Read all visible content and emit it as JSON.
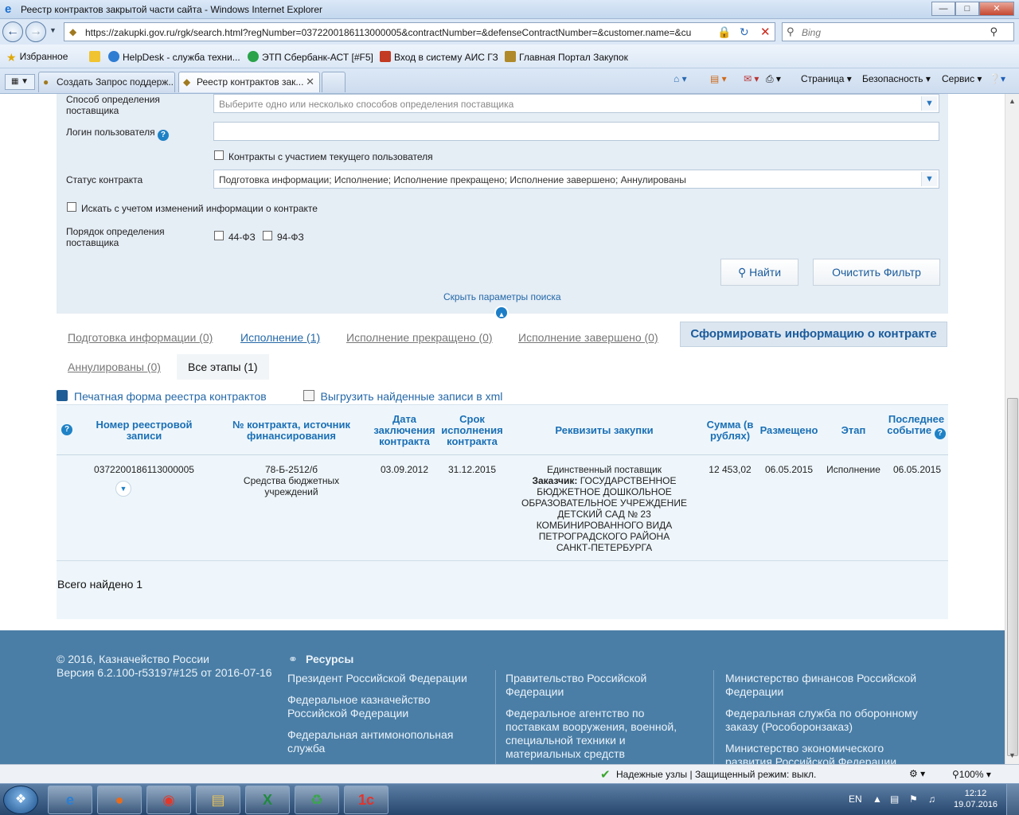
{
  "window": {
    "title": "Реестр контрактов закрытой части сайта - Windows Internet Explorer",
    "url": "https://zakupki.gov.ru/rgk/search.html?regNumber=0372200186113000005&contractNumber=&defenseContractNumber=&customer.name=&cu",
    "search_placeholder": "Bing"
  },
  "favorites": {
    "label": "Избранное",
    "items": [
      "HelpDesk - служба техни...",
      "ЭТП Сбербанк-АСТ [#F5]",
      "Вход в систему  АИС ГЗ",
      "Главная Портал Закупок"
    ]
  },
  "tabs": [
    {
      "label": "Создать Запрос поддерж..."
    },
    {
      "label": "Реестр контрактов зак..."
    }
  ],
  "commands": [
    "Страница",
    "Безопасность",
    "Сервис"
  ],
  "filter": {
    "method_label": "Способ определения поставщика",
    "method_placeholder": "Выберите одно или несколько способов определения поставщика",
    "login_label": "Логин пользователя",
    "login_value": "",
    "my_contracts_label": "Контракты с участием текущего пользователя",
    "status_label": "Статус контракта",
    "status_value": "Подготовка информации; Исполнение; Исполнение прекращено; Исполнение завершено; Аннулированы",
    "search_changes_label": "Искать с учетом изменений информации о контракте",
    "order_label": "Порядок определения поставщика",
    "law44": "44-ФЗ",
    "law94": "94-ФЗ",
    "find_button": "Найти",
    "clear_button": "Очистить Фильтр",
    "hide_link": "Скрыть параметры поиска"
  },
  "stage_tabs": [
    "Подготовка информации (0)",
    "Исполнение (1)",
    "Исполнение прекращено (0)",
    "Исполнение завершено (0)",
    "Аннулированы (0)",
    "Все этапы (1)"
  ],
  "form_button": "Сформировать информацию о контракте",
  "tools": {
    "print": "Печатная форма реестра контрактов",
    "export": "Выгрузить найденные записи в xml"
  },
  "table": {
    "headers": {
      "reg": "Номер реестровой записи",
      "contract": "№ контракта, источник финансирования",
      "date": "Дата заключения контракта",
      "term": "Срок исполнения контракта",
      "req": "Реквизиты закупки",
      "sum": "Сумма (в рублях)",
      "placed": "Размещено",
      "stage": "Этап",
      "last": "Последнее событие"
    },
    "row": {
      "reg": "0372200186113000005",
      "contract_no": "78-Б-2512/б",
      "funding": "Средства бюджетных учреждений",
      "date": "03.09.2012",
      "term": "31.12.2015",
      "method": "Единственный поставщик",
      "customer_label": "Заказчик:",
      "customer": "ГОСУДАРСТВЕННОЕ БЮДЖЕТНОЕ ДОШКОЛЬНОЕ ОБРАЗОВАТЕЛЬНОЕ УЧРЕЖДЕНИЕ ДЕТСКИЙ САД № 23 КОМБИНИРОВАННОГО ВИДА ПЕТРОГРАДСКОГО РАЙОНА САНКТ-ПЕТЕРБУРГА",
      "sum": "12 453,02",
      "placed": "06.05.2015",
      "stage": "Исполнение",
      "last": "06.05.2015"
    },
    "total": "Всего найдено 1"
  },
  "footer": {
    "copyright": "© 2016, Казначейство России",
    "version": "Версия 6.2.100-r53197#125 от 2016-07-16",
    "resources_title": "Ресурсы",
    "col1": [
      "Президент Российской Федерации",
      "Федеральное казначейство Российской Федерации",
      "Федеральная антимонопольная служба"
    ],
    "col2": [
      "Правительство Российской Федерации",
      "Федеральное агентство по поставкам вооружения, военной, специальной техники и материальных средств"
    ],
    "col3": [
      "Министерство финансов Российской Федерации",
      "Федеральная служба по оборонному заказу (Рособоронзаказ)",
      "Министерство экономического развития Российской Федерации"
    ]
  },
  "status": {
    "message": "Надежные узлы | Защищенный режим: выкл.",
    "zoom": "100%"
  },
  "taskbar": {
    "lang": "EN",
    "time": "12:12",
    "date": "19.07.2016"
  },
  "colors": {
    "accent": "#1a6fb5",
    "filter_bg": "#e5edf5",
    "footer_bg": "#4a7ea6"
  }
}
